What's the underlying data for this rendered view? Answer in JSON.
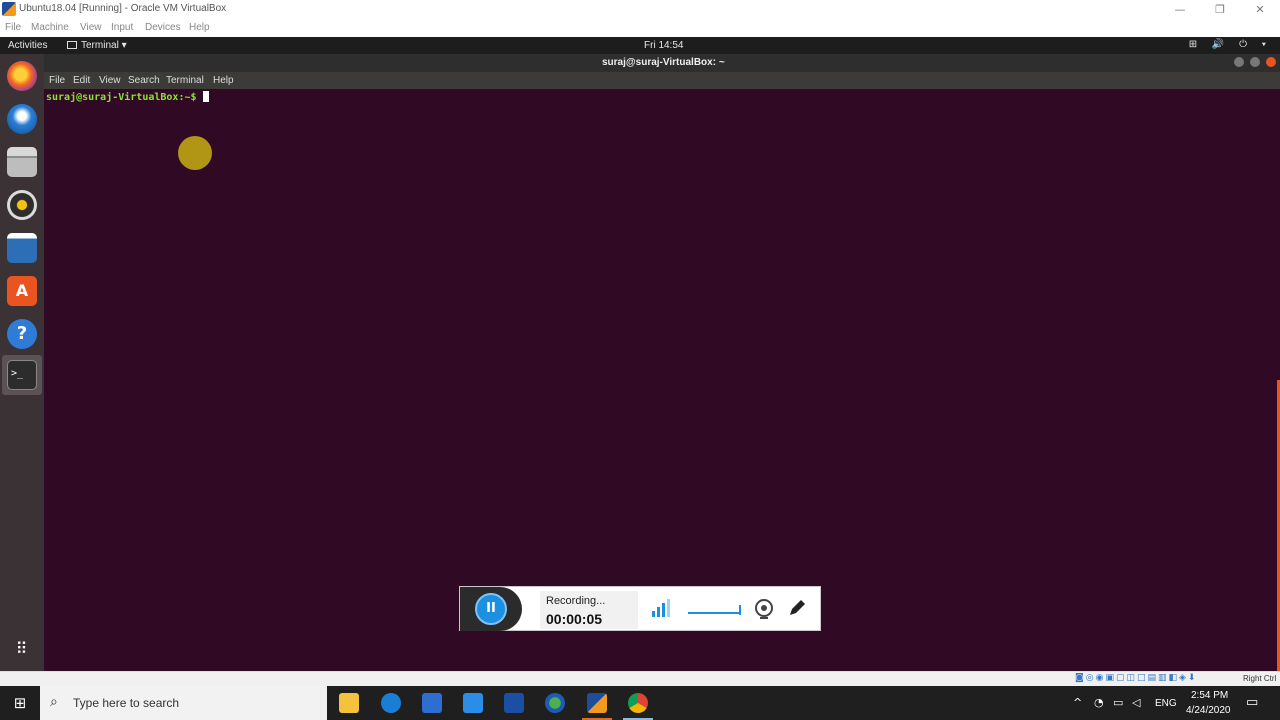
{
  "vbox": {
    "title": "Ubuntu18.04 [Running] - Oracle VM VirtualBox",
    "window_controls": {
      "minimize": "—",
      "restore": "❐",
      "close": "✕"
    },
    "menu": [
      "File",
      "Machine",
      "View",
      "Input",
      "Devices",
      "Help"
    ],
    "status_right": "Right Ctrl"
  },
  "ubuntu": {
    "activities": "Activities",
    "app_menu": "Terminal ▾",
    "clock": "Fri 14:54",
    "tray": "⊞ 🔊 ⏻ ▾"
  },
  "terminal": {
    "title": "suraj@suraj-VirtualBox: ~",
    "menu": [
      "File",
      "Edit",
      "View",
      "Search",
      "Terminal",
      "Help"
    ],
    "prompt": "suraj@suraj-VirtualBox:~$ "
  },
  "recorder": {
    "status": "Recording...",
    "time": "00:00:05",
    "pause_icon": "pause-icon"
  },
  "taskbar": {
    "search_placeholder": "Type here to search",
    "time": "2:54 PM",
    "date": "4/24/2020",
    "lang": "ENG",
    "notification_icon": "▭"
  },
  "colors": {
    "terminal_bg": "#300a24",
    "prompt_green": "#8ae234",
    "ubuntu_orange": "#e95420",
    "accent_blue": "#1d8fe1"
  }
}
